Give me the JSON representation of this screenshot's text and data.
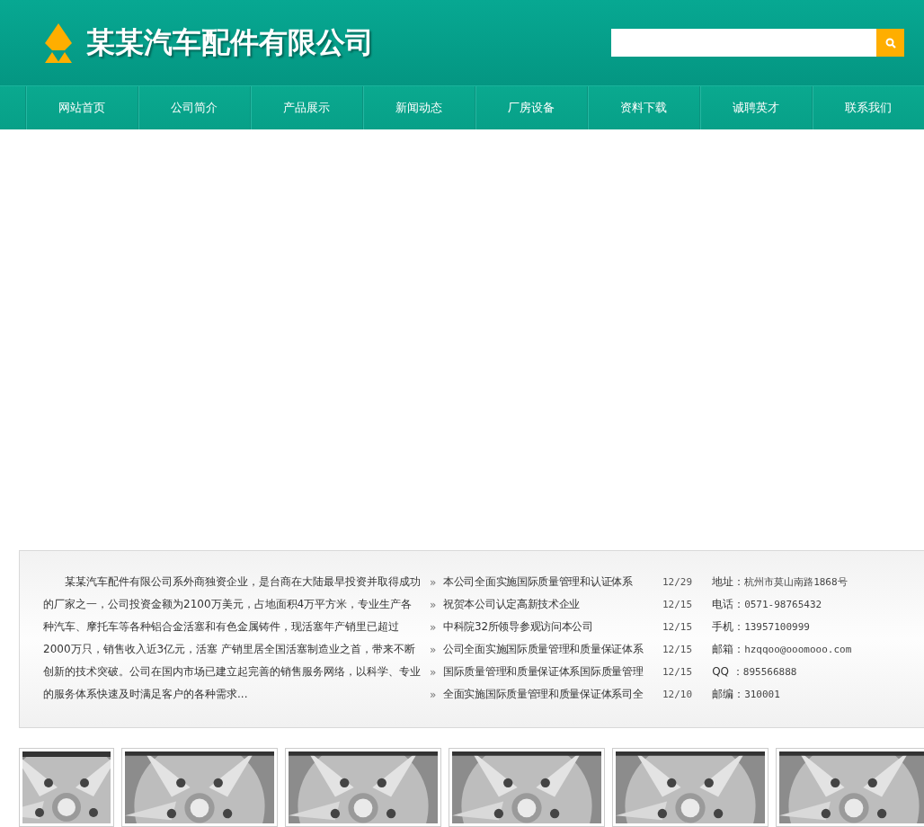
{
  "header": {
    "company_name": "某某汽车配件有限公司"
  },
  "nav": [
    {
      "label": "网站首页"
    },
    {
      "label": "公司简介"
    },
    {
      "label": "产品展示"
    },
    {
      "label": "新闻动态"
    },
    {
      "label": "厂房设备"
    },
    {
      "label": "资料下载"
    },
    {
      "label": "诚聘英才"
    },
    {
      "label": "联系我们"
    }
  ],
  "intro": "某某汽车配件有限公司系外商独资企业，是台商在大陆最早投资并取得成功的厂家之一，公司投资金额为2100万美元，占地面积4万平方米，专业生产各种汽车、摩托车等各种铝合金活塞和有色金属铸件，现活塞年产销里已超过2000万只，销售收入近3亿元，活塞 产销里居全国活塞制造业之首，带来不断创新的技术突破。公司在国内市场已建立起完善的销售服务网络，以科学、专业的服务体系快速及时满足客户的各种需求...",
  "news": [
    {
      "marker": "»",
      "title": "本公司全面实施国际质量管理和认证体系",
      "date": "12/29"
    },
    {
      "marker": "»",
      "title": "祝贺本公司认定高新技术企业",
      "date": "12/15"
    },
    {
      "marker": "»",
      "title": "中科院32所领导参观访问本公司",
      "date": "12/15"
    },
    {
      "marker": "»",
      "title": "公司全面实施国际质量管理和质量保证体系",
      "date": "12/15"
    },
    {
      "marker": "»",
      "title": "国际质量管理和质量保证体系国际质量管理",
      "date": "12/15"
    },
    {
      "marker": "»",
      "title": "全面实施国际质量管理和质量保证体系司全",
      "date": "12/10"
    }
  ],
  "contact": [
    {
      "label": "地址：",
      "value": "杭州市莫山南路1868号"
    },
    {
      "label": "电话：",
      "value": "0571-98765432"
    },
    {
      "label": "手机：",
      "value": "13957100999"
    },
    {
      "label": "邮箱：",
      "value": "hzqqoo@ooomooo.com"
    },
    {
      "label": "QQ ：",
      "value": "895566888"
    },
    {
      "label": "邮编：",
      "value": "310001"
    }
  ]
}
